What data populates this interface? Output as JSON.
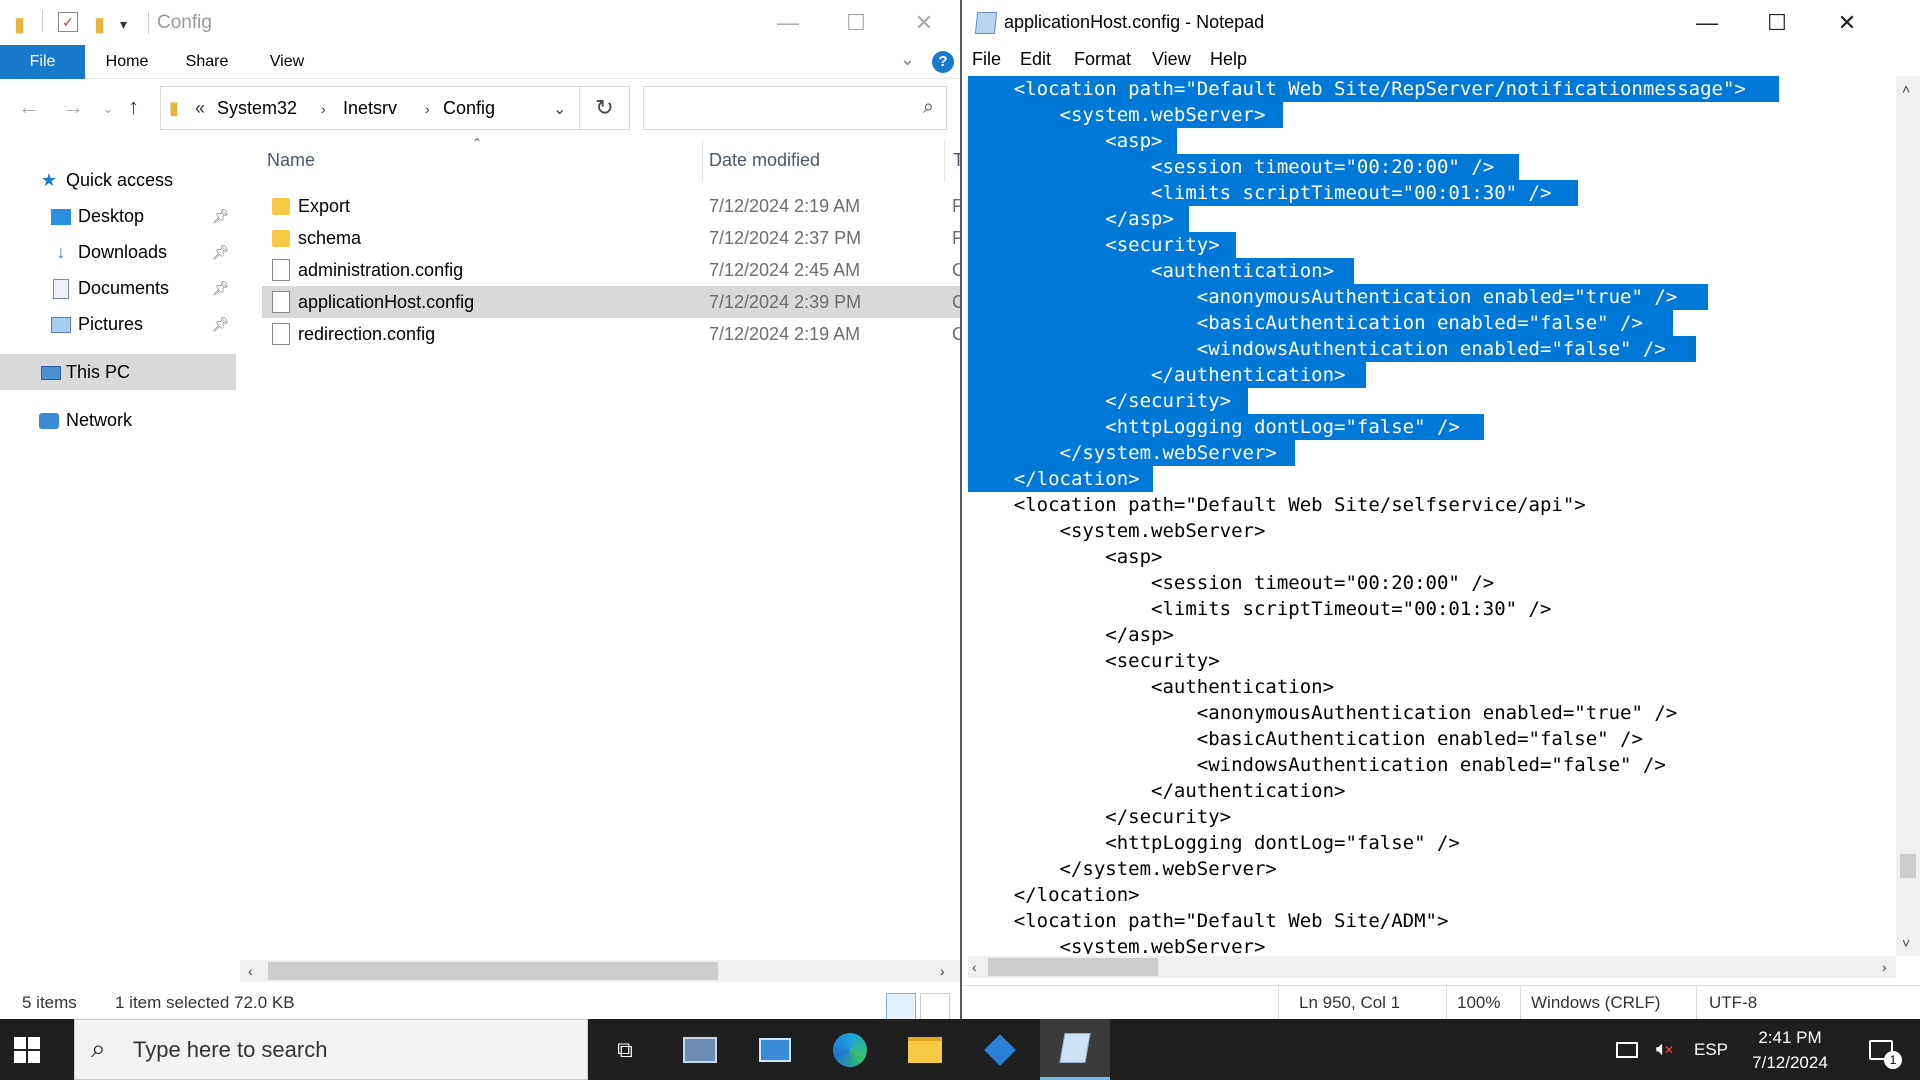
{
  "explorer": {
    "title": "Config",
    "ribbon_tabs": [
      "File",
      "Home",
      "Share",
      "View"
    ],
    "address_overflow": "«",
    "address_crumbs": [
      "System32",
      "Inetsrv",
      "Config"
    ],
    "search_placeholder": "",
    "nav_items": [
      {
        "label": "Quick access",
        "icon": "star-icon"
      },
      {
        "label": "Desktop",
        "icon": "desktop-icon",
        "pinned": true
      },
      {
        "label": "Downloads",
        "icon": "download-arrow-icon",
        "pinned": true
      },
      {
        "label": "Documents",
        "icon": "documents-icon",
        "pinned": true
      },
      {
        "label": "Pictures",
        "icon": "pictures-icon",
        "pinned": true
      },
      {
        "label": "This PC",
        "icon": "computer-icon",
        "selected": true
      },
      {
        "label": "Network",
        "icon": "network-icon"
      }
    ],
    "columns": {
      "name": "Name",
      "date": "Date modified",
      "type": "T"
    },
    "files": [
      {
        "name": "Export",
        "date": "7/12/2024 2:19 AM",
        "type": "F",
        "kind": "folder"
      },
      {
        "name": "schema",
        "date": "7/12/2024 2:37 PM",
        "type": "F",
        "kind": "folder"
      },
      {
        "name": "administration.config",
        "date": "7/12/2024 2:45 AM",
        "type": "C",
        "kind": "file"
      },
      {
        "name": "applicationHost.config",
        "date": "7/12/2024 2:39 PM",
        "type": "C",
        "kind": "file",
        "selected": true
      },
      {
        "name": "redirection.config",
        "date": "7/12/2024 2:19 AM",
        "type": "C",
        "kind": "file"
      }
    ],
    "status": {
      "count": "5 items",
      "selection": "1 item selected  72.0 KB"
    }
  },
  "notepad": {
    "title": "applicationHost.config - Notepad",
    "menu": [
      "File",
      "Edit",
      "Format",
      "View",
      "Help"
    ],
    "lines": [
      {
        "text": "    <location path=\"Default Web Site/RepServer/notificationmessage\">",
        "selected": true
      },
      {
        "text": "        <system.webServer>",
        "selected": true
      },
      {
        "text": "            <asp>",
        "selected": true
      },
      {
        "text": "                <session timeout=\"00:20:00\" />",
        "selected": true
      },
      {
        "text": "                <limits scriptTimeout=\"00:01:30\" />",
        "selected": true
      },
      {
        "text": "            </asp>",
        "selected": true
      },
      {
        "text": "            <security>",
        "selected": true
      },
      {
        "text": "                <authentication>",
        "selected": true
      },
      {
        "text": "                    <anonymousAuthentication enabled=\"true\" />",
        "selected": true
      },
      {
        "text": "                    <basicAuthentication enabled=\"false\" />",
        "selected": true
      },
      {
        "text": "                    <windowsAuthentication enabled=\"false\" />",
        "selected": true
      },
      {
        "text": "                </authentication>",
        "selected": true
      },
      {
        "text": "            </security>",
        "selected": true
      },
      {
        "text": "            <httpLogging dontLog=\"false\" />",
        "selected": true
      },
      {
        "text": "        </system.webServer>",
        "selected": true
      },
      {
        "text": "    </location>",
        "selected": true
      },
      {
        "text": "    <location path=\"Default Web Site/selfservice/api\">",
        "selected": false
      },
      {
        "text": "        <system.webServer>",
        "selected": false
      },
      {
        "text": "            <asp>",
        "selected": false
      },
      {
        "text": "                <session timeout=\"00:20:00\" />",
        "selected": false
      },
      {
        "text": "                <limits scriptTimeout=\"00:01:30\" />",
        "selected": false
      },
      {
        "text": "            </asp>",
        "selected": false
      },
      {
        "text": "            <security>",
        "selected": false
      },
      {
        "text": "                <authentication>",
        "selected": false
      },
      {
        "text": "                    <anonymousAuthentication enabled=\"true\" />",
        "selected": false
      },
      {
        "text": "                    <basicAuthentication enabled=\"false\" />",
        "selected": false
      },
      {
        "text": "                    <windowsAuthentication enabled=\"false\" />",
        "selected": false
      },
      {
        "text": "                </authentication>",
        "selected": false
      },
      {
        "text": "            </security>",
        "selected": false
      },
      {
        "text": "            <httpLogging dontLog=\"false\" />",
        "selected": false
      },
      {
        "text": "        </system.webServer>",
        "selected": false
      },
      {
        "text": "    </location>",
        "selected": false
      },
      {
        "text": "    <location path=\"Default Web Site/ADM\">",
        "selected": false
      },
      {
        "text": "        <system.webServer>",
        "selected": false
      }
    ],
    "status": {
      "position": "Ln 950, Col 1",
      "zoom": "100%",
      "line_ending": "Windows (CRLF)",
      "encoding": "UTF-8"
    }
  },
  "taskbar": {
    "search_placeholder": "Type here to search",
    "apps": [
      "task-view-icon",
      "server-manager-icon",
      "control-panel-icon",
      "edge-icon",
      "file-explorer-icon",
      "azure-icon",
      "notepad-icon"
    ],
    "language": "ESP",
    "time": "2:41 PM",
    "date": "7/12/2024",
    "notification_count": "1"
  },
  "colors": {
    "accent": "#1979ca",
    "selection": "#0078d7",
    "row_selected": "#d9d9d9",
    "taskbar": "#1f1f1f"
  }
}
